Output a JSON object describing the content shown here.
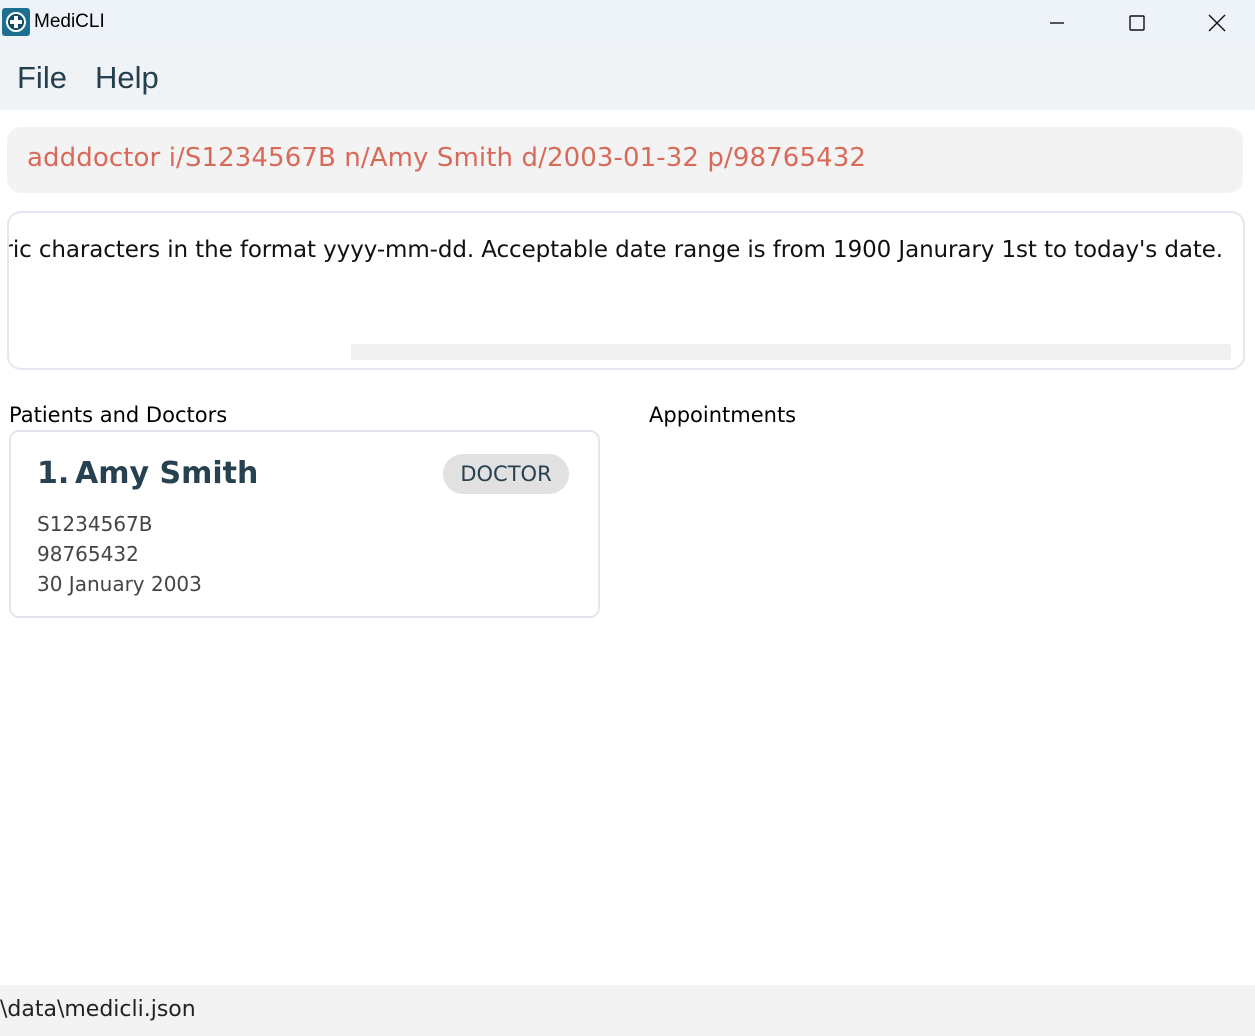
{
  "window": {
    "title": "MediCLI",
    "icon": "medicli-app-icon",
    "controls": [
      "minimize-icon",
      "maximize-icon",
      "close-icon"
    ]
  },
  "menu": {
    "items": [
      {
        "label": "File"
      },
      {
        "label": "Help"
      }
    ]
  },
  "command": {
    "value": "adddoctor i/S1234567B n/Amy Smith d/2003-01-32 p/98765432",
    "color": "#d86a5a"
  },
  "result": {
    "visible_text": "eric characters in the format yyyy-mm-dd. Acceptable date range is from 1900 Janurary 1st to today's date."
  },
  "lists": {
    "persons_label": "Patients and Doctors",
    "appointments_label": "Appointments",
    "persons": [
      {
        "index": "1.",
        "name": "Amy Smith",
        "type": "DOCTOR",
        "nric": "S1234567B",
        "phone": "98765432",
        "dob": "30 January 2003"
      }
    ]
  },
  "status": {
    "path": "\\data\\medicli.json"
  }
}
